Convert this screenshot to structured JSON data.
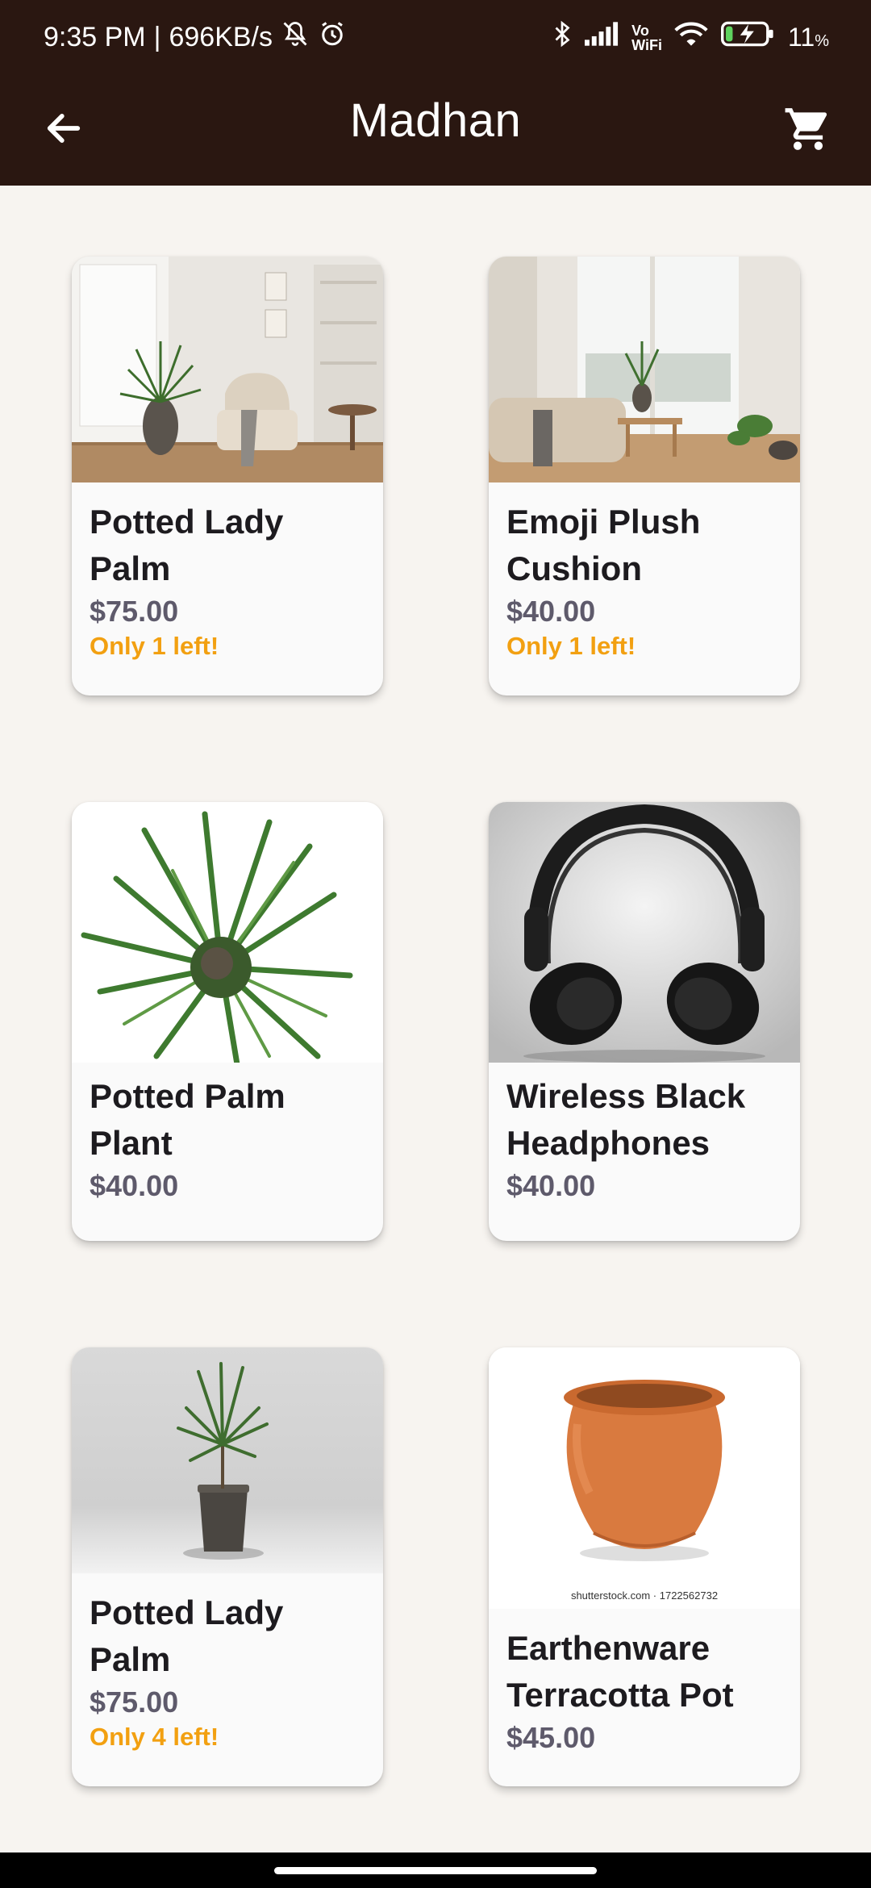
{
  "status_bar": {
    "time": "9:35 PM",
    "separator": "|",
    "net_speed": "696KB/s",
    "battery_value": "11",
    "battery_unit": "%",
    "vowifi_top": "Vo",
    "vowifi_bottom": "WiFi"
  },
  "app_bar": {
    "title": "Madhan",
    "back_icon": "arrow-left-icon",
    "cart_icon": "shopping-cart-icon"
  },
  "products": [
    {
      "name": "Potted Lady Palm",
      "price": "$75.00",
      "stock": "Only 1 left!"
    },
    {
      "name": "Emoji Plush Cushion",
      "price": "$40.00",
      "stock": "Only 1 left!"
    },
    {
      "name": "Potted Palm Plant",
      "price": "$40.00",
      "stock": ""
    },
    {
      "name": "Wireless Black Headphones",
      "price": "$40.00",
      "stock": ""
    },
    {
      "name": "Potted Lady Palm",
      "price": "$75.00",
      "stock": "Only 4 left!"
    },
    {
      "name": "Earthenware Terracotta Pot",
      "price": "$45.00",
      "stock": ""
    }
  ],
  "image_watermarks": {
    "terracotta": "shutterstock.com · 1722562732"
  },
  "colors": {
    "app_bar": "#2a1711",
    "background": "#f7f4f0",
    "price": "#5e5a6b",
    "stock_warning": "#f2a011"
  }
}
